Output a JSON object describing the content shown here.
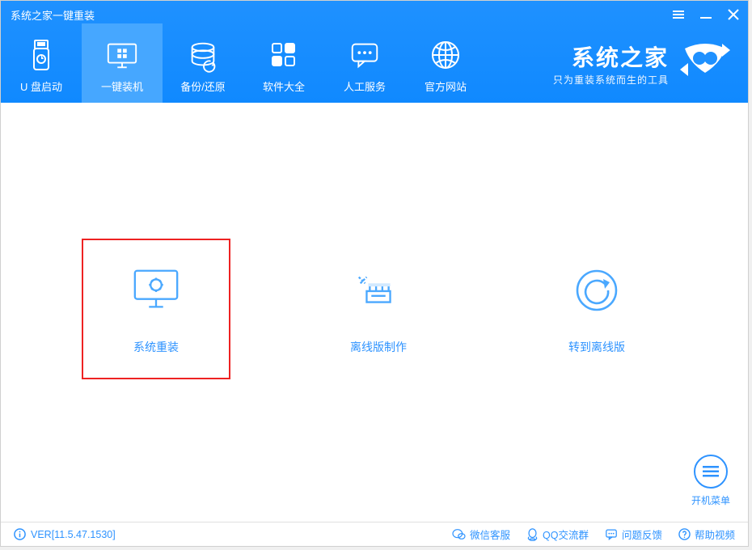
{
  "window": {
    "title": "系统之家一键重装"
  },
  "nav": {
    "items": [
      {
        "label": "U 盘启动",
        "icon": "usb-icon"
      },
      {
        "label": "一键装机",
        "icon": "monitor-icon"
      },
      {
        "label": "备份/还原",
        "icon": "backup-icon"
      },
      {
        "label": "软件大全",
        "icon": "apps-icon"
      },
      {
        "label": "人工服务",
        "icon": "chat-icon"
      },
      {
        "label": "官方网站",
        "icon": "globe-icon"
      }
    ]
  },
  "brand": {
    "title": "系统之家",
    "sub": "只为重装系统而生的工具"
  },
  "cards": [
    {
      "label": "系统重装",
      "icon": "reinstall-icon",
      "highlighted": true
    },
    {
      "label": "离线版制作",
      "icon": "offline-make-icon"
    },
    {
      "label": "转到离线版",
      "icon": "offline-switch-icon"
    }
  ],
  "floatMenu": {
    "label": "开机菜单"
  },
  "footer": {
    "version": "VER[11.5.47.1530]",
    "links": [
      {
        "label": "微信客服",
        "icon": "wechat-icon"
      },
      {
        "label": "QQ交流群",
        "icon": "qq-icon"
      },
      {
        "label": "问题反馈",
        "icon": "feedback-icon"
      },
      {
        "label": "帮助视频",
        "icon": "help-icon"
      }
    ]
  }
}
